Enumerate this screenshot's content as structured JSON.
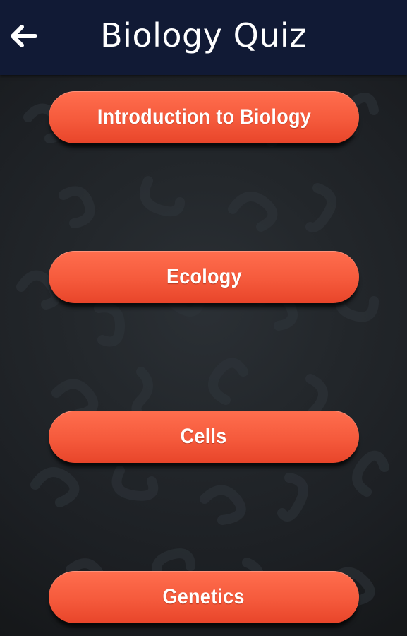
{
  "header": {
    "title": "Biology Quiz",
    "back_icon": "arrow-left-icon"
  },
  "colors": {
    "header_bg": "#111a35",
    "button_accent": "#f55a3c",
    "background": "#23272b"
  },
  "topics": [
    {
      "label": "Introduction to Biology"
    },
    {
      "label": "Ecology"
    },
    {
      "label": "Cells"
    },
    {
      "label": "Genetics"
    }
  ]
}
